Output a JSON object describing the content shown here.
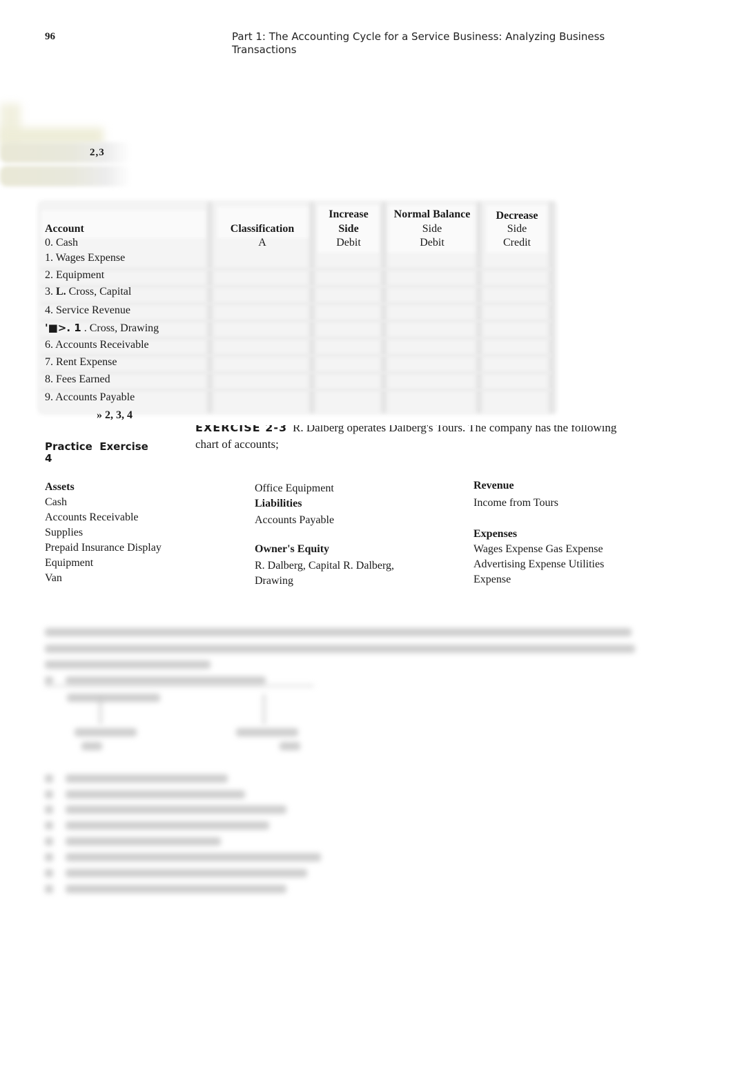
{
  "header": {
    "page_number": "96",
    "running_head": "Part 1: The Accounting Cycle for a Service Business: Analyzing Business Transactions"
  },
  "margin": {
    "tab_1_label": "2,3"
  },
  "table": {
    "headers": {
      "account": "Account",
      "classification": "Classification",
      "increase_line1": "Increase",
      "increase_line2": "Side",
      "normal_line1": "Normal Balance",
      "normal_line2": "Side",
      "decrease_line1": "Decrease",
      "decrease_line2": "Side"
    },
    "rows": [
      {
        "prefix": "0.",
        "bold_part": "",
        "name": "Cash",
        "classification": "A",
        "increase": "Debit",
        "normal": "Debit",
        "decrease": "Credit"
      },
      {
        "prefix": "1.",
        "bold_part": "",
        "name": "Wages Expense",
        "classification": "",
        "increase": "",
        "normal": "",
        "decrease": ""
      },
      {
        "prefix": "2.",
        "bold_part": "",
        "name": "Equipment",
        "classification": "",
        "increase": "",
        "normal": "",
        "decrease": ""
      },
      {
        "prefix": "3.",
        "bold_part": "L.",
        "name": "Cross, Capital",
        "classification": "",
        "increase": "",
        "normal": "",
        "decrease": ""
      },
      {
        "prefix": "4.",
        "bold_part": "",
        "name": "Service Revenue",
        "classification": "",
        "increase": "",
        "normal": "",
        "decrease": ""
      },
      {
        "prefix": "'■>. 1",
        "bold_part": "",
        "name": ". Cross, Drawing",
        "classification": "",
        "increase": "",
        "normal": "",
        "decrease": ""
      },
      {
        "prefix": "6.",
        "bold_part": "",
        "name": "Accounts Receivable",
        "classification": "",
        "increase": "",
        "normal": "",
        "decrease": ""
      },
      {
        "prefix": "7.",
        "bold_part": "",
        "name": "Rent Expense",
        "classification": "",
        "increase": "",
        "normal": "",
        "decrease": ""
      },
      {
        "prefix": "8.",
        "bold_part": "",
        "name": "Fees Earned",
        "classification": "",
        "increase": "",
        "normal": "",
        "decrease": ""
      },
      {
        "prefix": "9.",
        "bold_part": "",
        "name": "Accounts Payable",
        "classification": "",
        "increase": "",
        "normal": "",
        "decrease": ""
      }
    ],
    "practice_ref": "» 2, 3, 4"
  },
  "exercise": {
    "title": "EXERCISE 2-3",
    "intro_line1": "R. Dalberg operates Dalberg's Tours. The company has the following",
    "intro_line2": "chart of accounts;",
    "practice_label_line1": "Practice  Exercise",
    "practice_label_line2": "4"
  },
  "chart_of_accounts": {
    "assets": {
      "heading": "Assets",
      "items": [
        "Cash",
        "Accounts Receivable",
        "Supplies",
        "Prepaid Insurance Display",
        "Equipment",
        "Van"
      ]
    },
    "col2_top_item": "Office Equipment",
    "liabilities": {
      "heading": "Liabilities",
      "items": [
        "Accounts Payable"
      ]
    },
    "owners_equity": {
      "heading": "Owner's Equity",
      "items": [
        "R. Dalberg, Capital R. Dalberg,",
        "Drawing"
      ]
    },
    "revenue": {
      "heading": "Revenue",
      "items": [
        "Income from Tours"
      ]
    },
    "expenses": {
      "heading": "Expenses",
      "items": [
        "Wages Expense Gas Expense",
        "Advertising Expense Utilities",
        "Expense"
      ]
    }
  }
}
